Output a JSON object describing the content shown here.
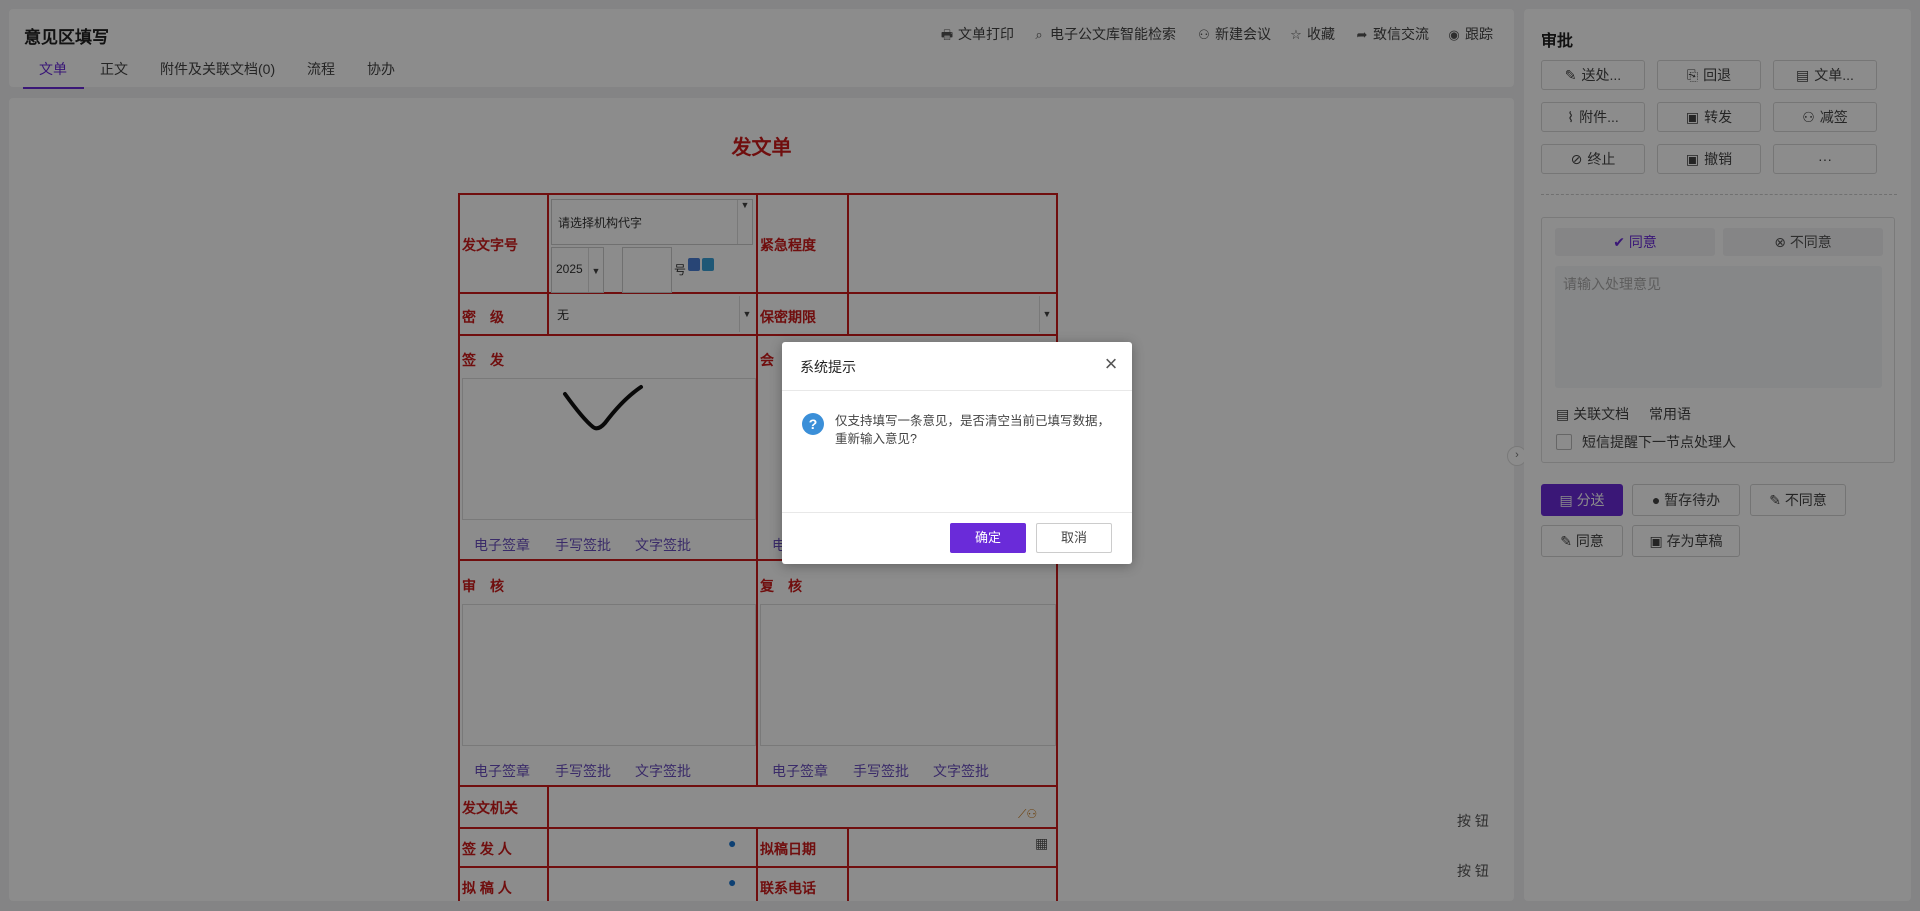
{
  "header": {
    "title": "意见区填写",
    "tabs": [
      {
        "label": "文单",
        "active": true
      },
      {
        "label": "正文"
      },
      {
        "label": "附件及关联文档(0)"
      },
      {
        "label": "流程"
      },
      {
        "label": "协办"
      }
    ],
    "toolbar": [
      {
        "icon": "printer-icon",
        "label": "文单打印"
      },
      {
        "icon": "search-doc-icon",
        "label": "电子公文库智能检索"
      },
      {
        "icon": "meeting-icon",
        "label": "新建会议"
      },
      {
        "icon": "star-icon",
        "label": "收藏"
      },
      {
        "icon": "share-icon",
        "label": "致信交流"
      },
      {
        "icon": "target-icon",
        "label": "跟踪"
      }
    ]
  },
  "form": {
    "title": "发文单",
    "doc_number_label": "发文字号",
    "org_code_placeholder": "请选择机构代字",
    "year": "2025",
    "hao": "号",
    "urgency_label": "紧急程度",
    "secret_level_label": "密　级",
    "secret_level_value": "无",
    "secret_period_label": "保密期限",
    "sign_label": "签　发",
    "countersign_label": "会",
    "review_label": "审　核",
    "recheck_label": "复　核",
    "sig_links": [
      "电子签章",
      "手写签批",
      "文字签批"
    ],
    "sig_link_partial": "电",
    "issuing_org_label": "发文机关",
    "signer_label": "签 发 人",
    "draft_date_label": "拟稿日期",
    "drafter_label": "拟 稿 人",
    "phone_label": "联系电话",
    "side_buttons": [
      "按 钮",
      "按 钮"
    ]
  },
  "panel": {
    "title": "审批",
    "actions": [
      {
        "icon": "send-icon",
        "label": "送处..."
      },
      {
        "icon": "return-icon",
        "label": "回退"
      },
      {
        "icon": "document-icon",
        "label": "文单..."
      },
      {
        "icon": "attachment-icon",
        "label": "附件..."
      },
      {
        "icon": "forward-icon",
        "label": "转发"
      },
      {
        "icon": "remove-signer-icon",
        "label": "减签"
      },
      {
        "icon": "stop-icon",
        "label": "终止"
      },
      {
        "icon": "revoke-icon",
        "label": "撤销"
      },
      {
        "icon": "more-icon",
        "label": "···"
      }
    ],
    "agree_label": "同意",
    "disagree_label": "不同意",
    "opinion_placeholder": "请输入处理意见",
    "related_doc_label": "关联文档",
    "common_phrases_label": "常用语",
    "sms_reminder_label": "短信提醒下一节点处理人",
    "bottom_buttons": [
      {
        "icon": "distribute-icon",
        "label": "分送",
        "primary": true
      },
      {
        "icon": "pending-icon",
        "label": "暂存待办"
      },
      {
        "icon": "edit-icon",
        "label": "不同意"
      },
      {
        "icon": "edit-icon",
        "label": "同意"
      },
      {
        "icon": "save-icon",
        "label": "存为草稿"
      }
    ]
  },
  "dialog": {
    "title": "系统提示",
    "message": "仅支持填写一条意见，是否清空当前已填写数据，重新输入意见?",
    "ok_label": "确定",
    "cancel_label": "取消"
  },
  "colors": {
    "accent": "#6a2bd9",
    "form_red": "#cc1b1b",
    "info_blue": "#3b8fd8"
  }
}
